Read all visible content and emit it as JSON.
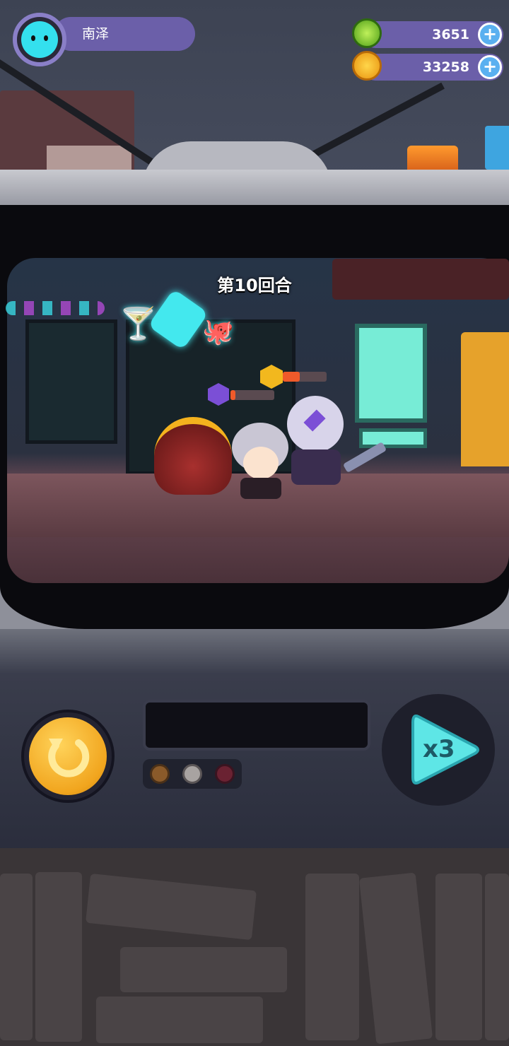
{
  "player": {
    "name": "南泽"
  },
  "currencies": [
    {
      "id": "gems",
      "value": "3651",
      "icon": "green-coin-icon",
      "color": "#6ac82a"
    },
    {
      "id": "gold",
      "value": "33258",
      "icon": "gold-planet-icon",
      "color": "#f3a31d"
    }
  ],
  "battle": {
    "round_label": "第10回合"
  },
  "controls": {
    "speed_label": "x3"
  },
  "colors": {
    "accent": "#6b5fa9",
    "plus": "#5ab0f0",
    "speed": "#5ee6e6",
    "restart": "#f1a51e"
  }
}
